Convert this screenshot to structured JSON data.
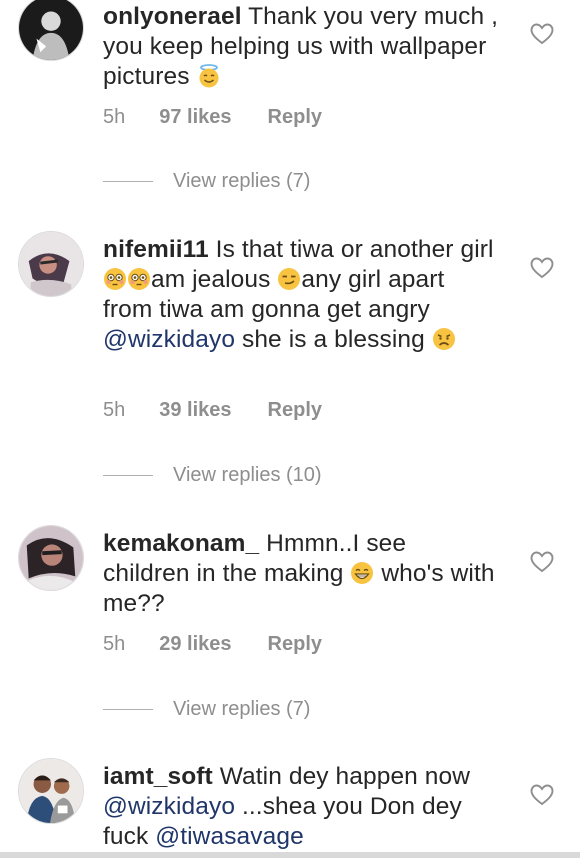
{
  "comments": [
    {
      "username": "onlyonerael",
      "text_1": " Thank you very much , you keep helping us with wallpaper pictures ",
      "time": "5h",
      "likes": "97 likes",
      "reply": "Reply",
      "view_replies": "View replies (7)"
    },
    {
      "username": "nifemii11",
      "text_1": " Is that  tiwa or another girl ",
      "text_2": "am jealous ",
      "text_3": "any girl apart from tiwa am gonna get angry ",
      "mention_1": "@wizkidayo",
      "text_4": " she is a blessing ",
      "time": "5h",
      "likes": "39 likes",
      "reply": "Reply",
      "view_replies": "View replies (10)"
    },
    {
      "username": "kemakonam_",
      "text_1": " Hmmn..I see children in the making ",
      "text_2": " who's with me??",
      "time": "5h",
      "likes": "29 likes",
      "reply": "Reply",
      "view_replies": "View replies (7)"
    },
    {
      "username": "iamt_soft",
      "text_1": " Watin dey happen now ",
      "mention_1": "@wizkidayo",
      "text_2": " ...shea you Don dey fuck ",
      "mention_2": "@tiwasavage"
    }
  ],
  "icons": {
    "like": "heart-outline-icon",
    "emoji_halo": "smiling-face-with-halo",
    "emoji_flushed": "flushed-face",
    "emoji_smirk": "smirking-face",
    "emoji_sad": "disappointed-face",
    "emoji_grin": "grinning-face"
  },
  "colors": {
    "text": "#262626",
    "secondary": "#8e8e8e",
    "mention": "#20366b",
    "emoji": "#f7c340"
  }
}
